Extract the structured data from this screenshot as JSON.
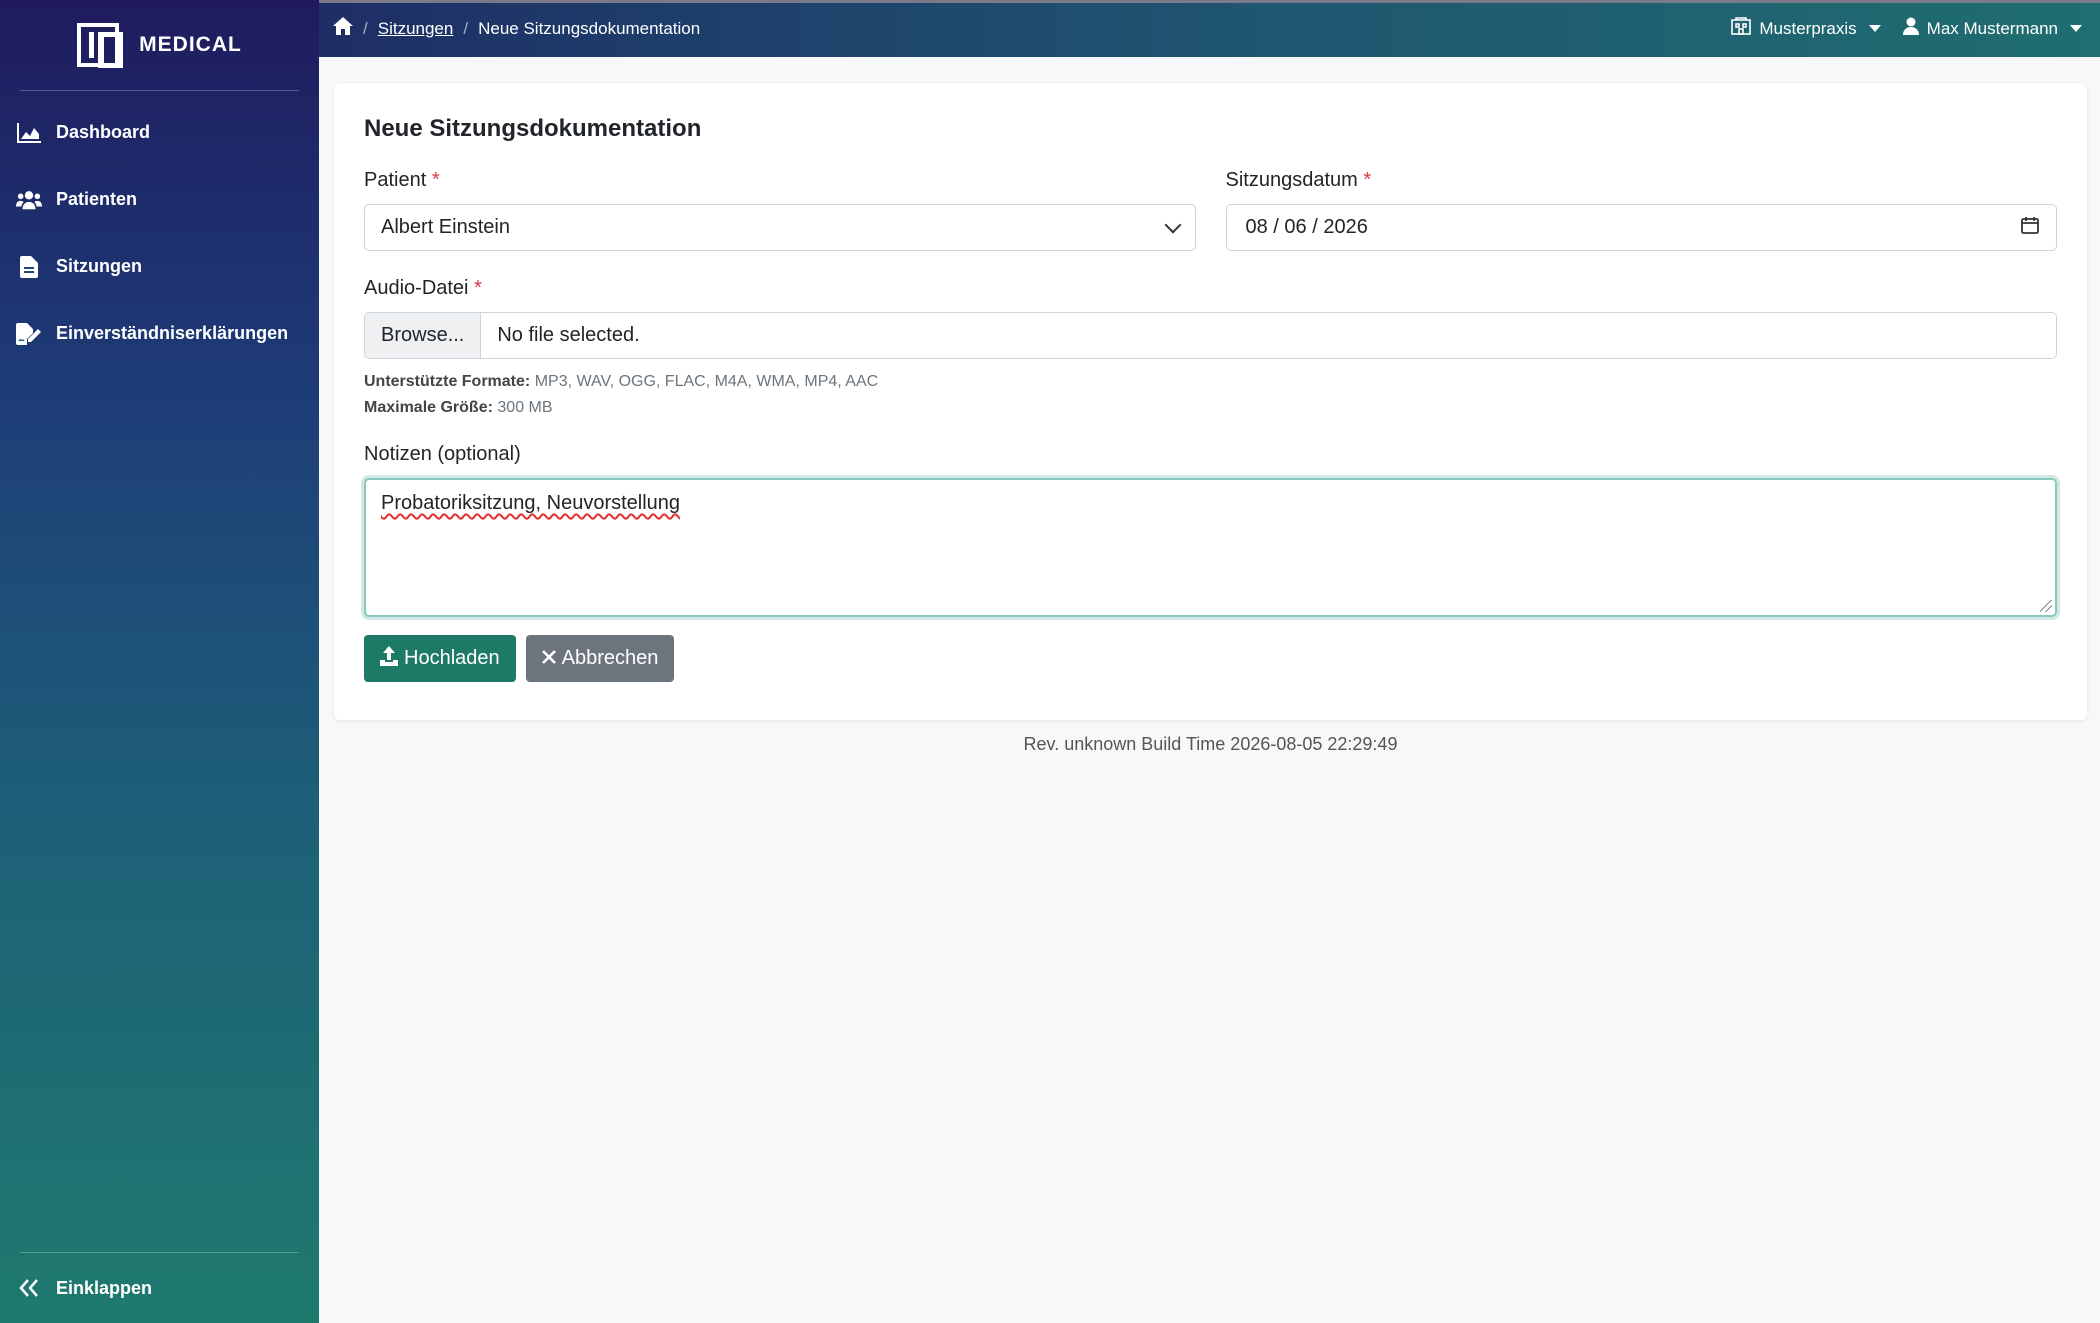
{
  "brand": {
    "name": "MEDICAL"
  },
  "sidebar": {
    "items": [
      {
        "label": "Dashboard",
        "icon": "chart-area-icon"
      },
      {
        "label": "Patienten",
        "icon": "users-icon"
      },
      {
        "label": "Sitzungen",
        "icon": "file-icon"
      },
      {
        "label": "Einverständniserklärungen",
        "icon": "file-signature-icon"
      }
    ],
    "collapse_label": "Einklappen"
  },
  "topbar": {
    "breadcrumb": {
      "link": "Sitzungen",
      "current": "Neue Sitzungsdokumentation"
    },
    "practice": "Musterpraxis",
    "user": "Max Mustermann"
  },
  "form": {
    "title": "Neue Sitzungsdokumentation",
    "patient_label": "Patient",
    "patient_value": "Albert Einstein",
    "date_label": "Sitzungsdatum",
    "date_value": "08 / 06 / 2026",
    "audio_label": "Audio-Datei",
    "browse_label": "Browse...",
    "file_status": "No file selected.",
    "formats_label": "Unterstützte Formate:",
    "formats_value": "MP3, WAV, OGG, FLAC, M4A, WMA, MP4, AAC",
    "maxsize_label": "Maximale Größe:",
    "maxsize_value": "300 MB",
    "notes_label": "Notizen (optional)",
    "notes_value": "Probatoriksitzung, Neuvorstellung",
    "upload_label": "Hochladen",
    "cancel_label": "Abbrechen",
    "required_mark": "*"
  },
  "footer": {
    "build": "Rev. unknown Build Time 2026-08-05 22:29:49"
  },
  "colors": {
    "primary": "#1d7a66",
    "secondary": "#6c757d",
    "required": "#dc3545"
  }
}
